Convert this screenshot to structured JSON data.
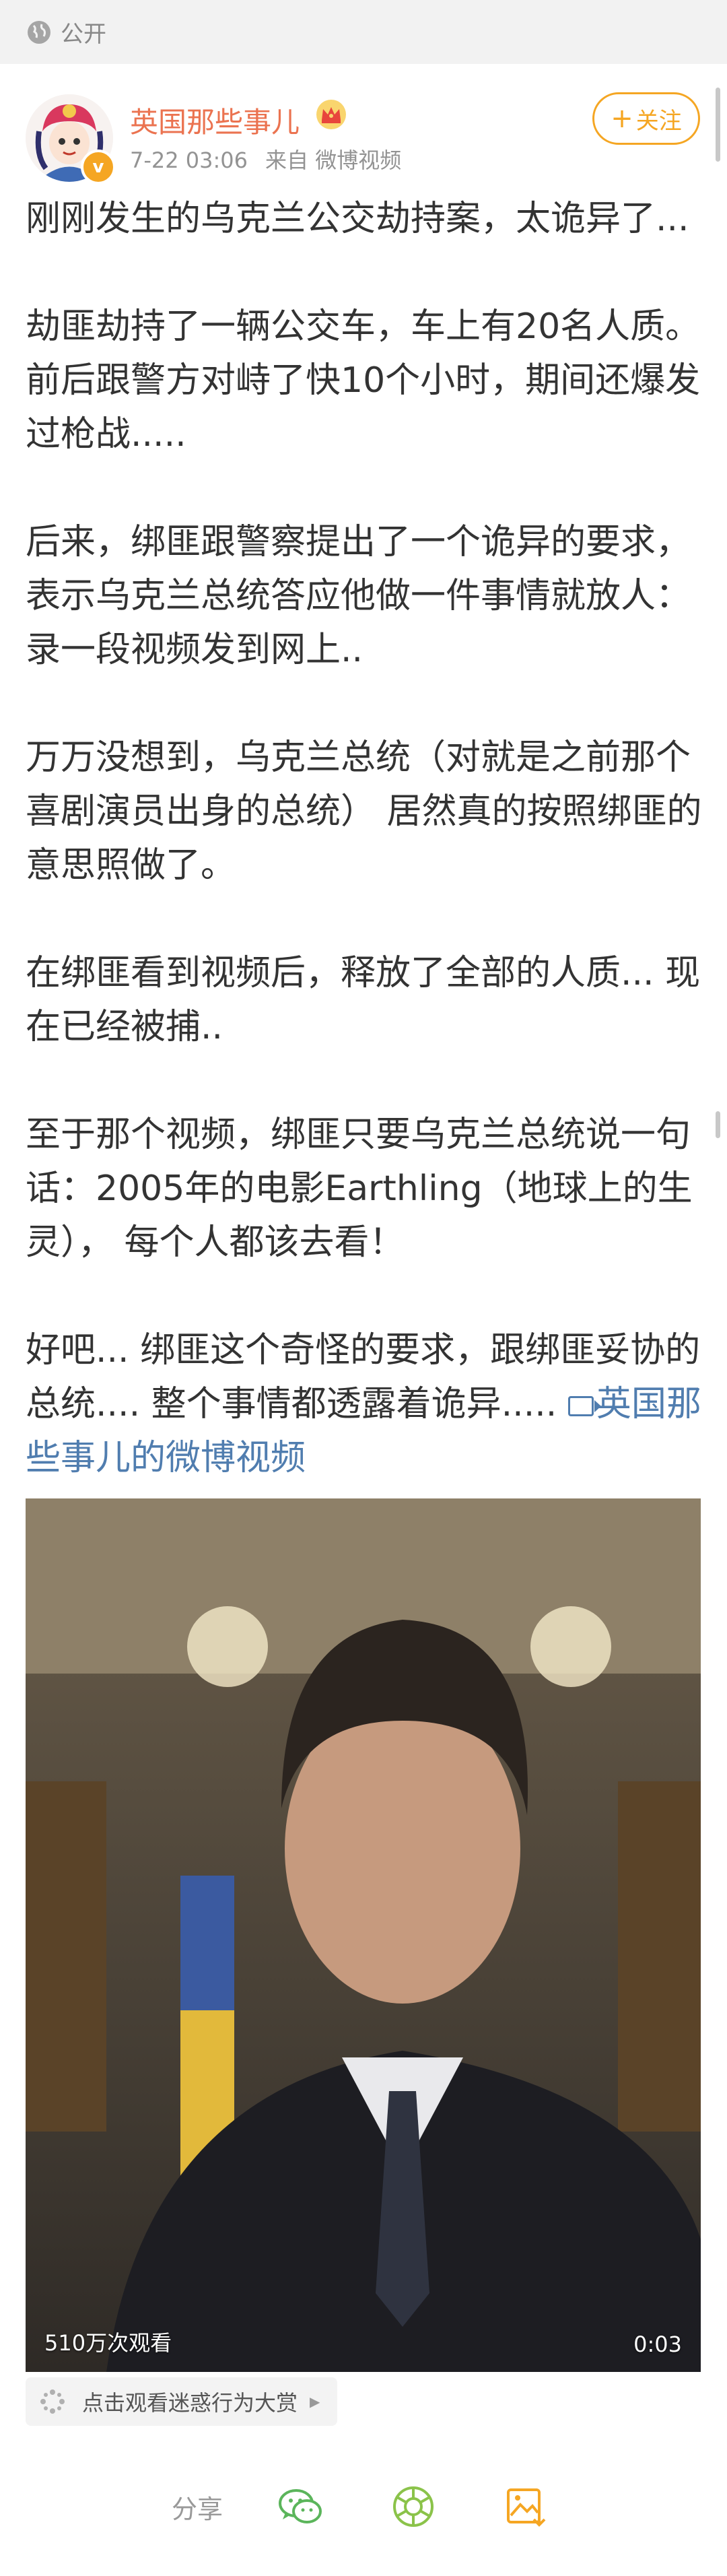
{
  "visibility": {
    "label": "公开",
    "icon": "globe-icon"
  },
  "author": {
    "name": "英国那些事儿",
    "badge_icon": "crown-icon",
    "verified_mark": "v",
    "time": "7-22 03:06",
    "source": "来自 微博视频"
  },
  "follow": {
    "plus": "+",
    "label": "关注"
  },
  "post": {
    "paragraphs": [
      "刚刚发生的乌克兰公交劫持案，太诡异了...",
      "劫匪劫持了一辆公交车，车上有20名人质。 前后跟警方对峙了快10个小时，期间还爆发过枪战.....",
      "后来，绑匪跟警察提出了一个诡异的要求，表示乌克兰总统答应他做一件事情就放人： 录一段视频发到网上..",
      "万万没想到，乌克兰总统（对就是之前那个喜剧演员出身的总统） 居然真的按照绑匪的意思照做了。",
      "在绑匪看到视频后，释放了全部的人质... 现在已经被捕..",
      "至于那个视频，绑匪只要乌克兰总统说一句话：2005年的电影Earthling（地球上的生灵）， 每个人都该去看！",
      "好吧... 绑匪这个奇怪的要求，跟绑匪妥协的总统.... 整个事情都透露着诡异....."
    ],
    "video_link": "英国那些事儿的微博视频"
  },
  "video": {
    "views": "510万次观看",
    "duration": "0:03"
  },
  "tag": {
    "label": "点击观看迷惑行为大赏",
    "icon": "sparkle-icon"
  },
  "share": {
    "label": "分享",
    "icons": [
      "wechat-icon",
      "moments-icon",
      "save-image-icon"
    ],
    "colors": {
      "wechat": "#5bb55b",
      "moments": "#8bc34a",
      "save": "#f5a623"
    }
  },
  "colors": {
    "accent": "#eb7350",
    "link": "#507daf",
    "follow": "#f5a623"
  }
}
